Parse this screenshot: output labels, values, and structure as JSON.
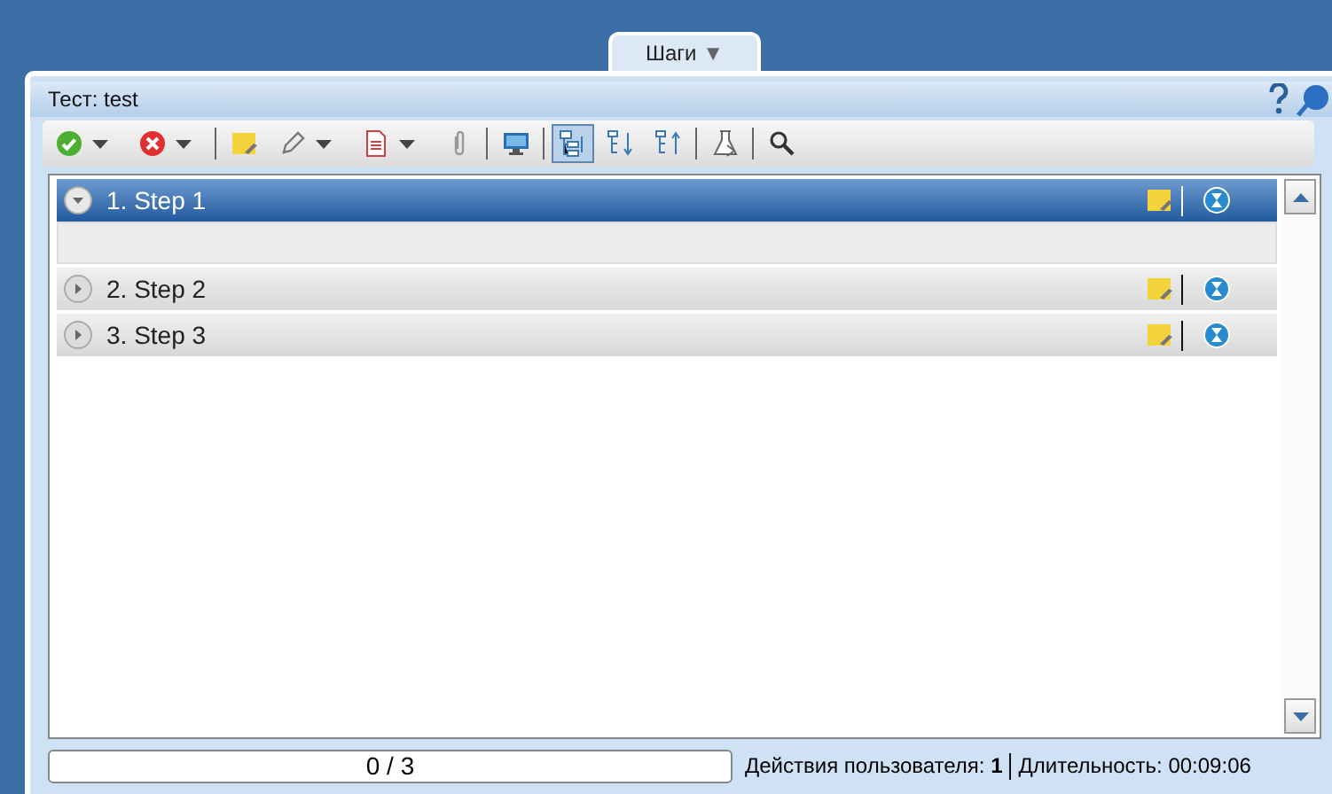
{
  "tab": {
    "label": "Шаги",
    "caret": "▼"
  },
  "panel": {
    "title": "Тест: test"
  },
  "toolbar": [
    {
      "kind": "check",
      "caret": true
    },
    {
      "kind": "cancel",
      "caret": true
    },
    {
      "kind": "sep"
    },
    {
      "kind": "note",
      "caret": false
    },
    {
      "kind": "pencil",
      "caret": true
    },
    {
      "kind": "doc",
      "caret": true
    },
    {
      "kind": "clip",
      "caret": false
    },
    {
      "kind": "sep"
    },
    {
      "kind": "monitor",
      "caret": false
    },
    {
      "kind": "sep"
    },
    {
      "kind": "tree",
      "caret": false,
      "pressed": true
    },
    {
      "kind": "treedown",
      "caret": false,
      "pressed": false
    },
    {
      "kind": "treeup",
      "caret": false,
      "pressed": false
    },
    {
      "kind": "sep"
    },
    {
      "kind": "flask",
      "caret": false
    },
    {
      "kind": "sep"
    },
    {
      "kind": "search",
      "caret": false
    }
  ],
  "steps": [
    {
      "label": "1. Step 1",
      "selected": true,
      "expanded": true
    },
    {
      "label": "2. Step 2",
      "selected": false,
      "expanded": false
    },
    {
      "label": "3. Step 3",
      "selected": false,
      "expanded": false
    }
  ],
  "status_bar": {
    "progress": "0 / 3",
    "actions": "Действия пользователя: **1**",
    "duration": "Длительность: 00:09:06"
  }
}
